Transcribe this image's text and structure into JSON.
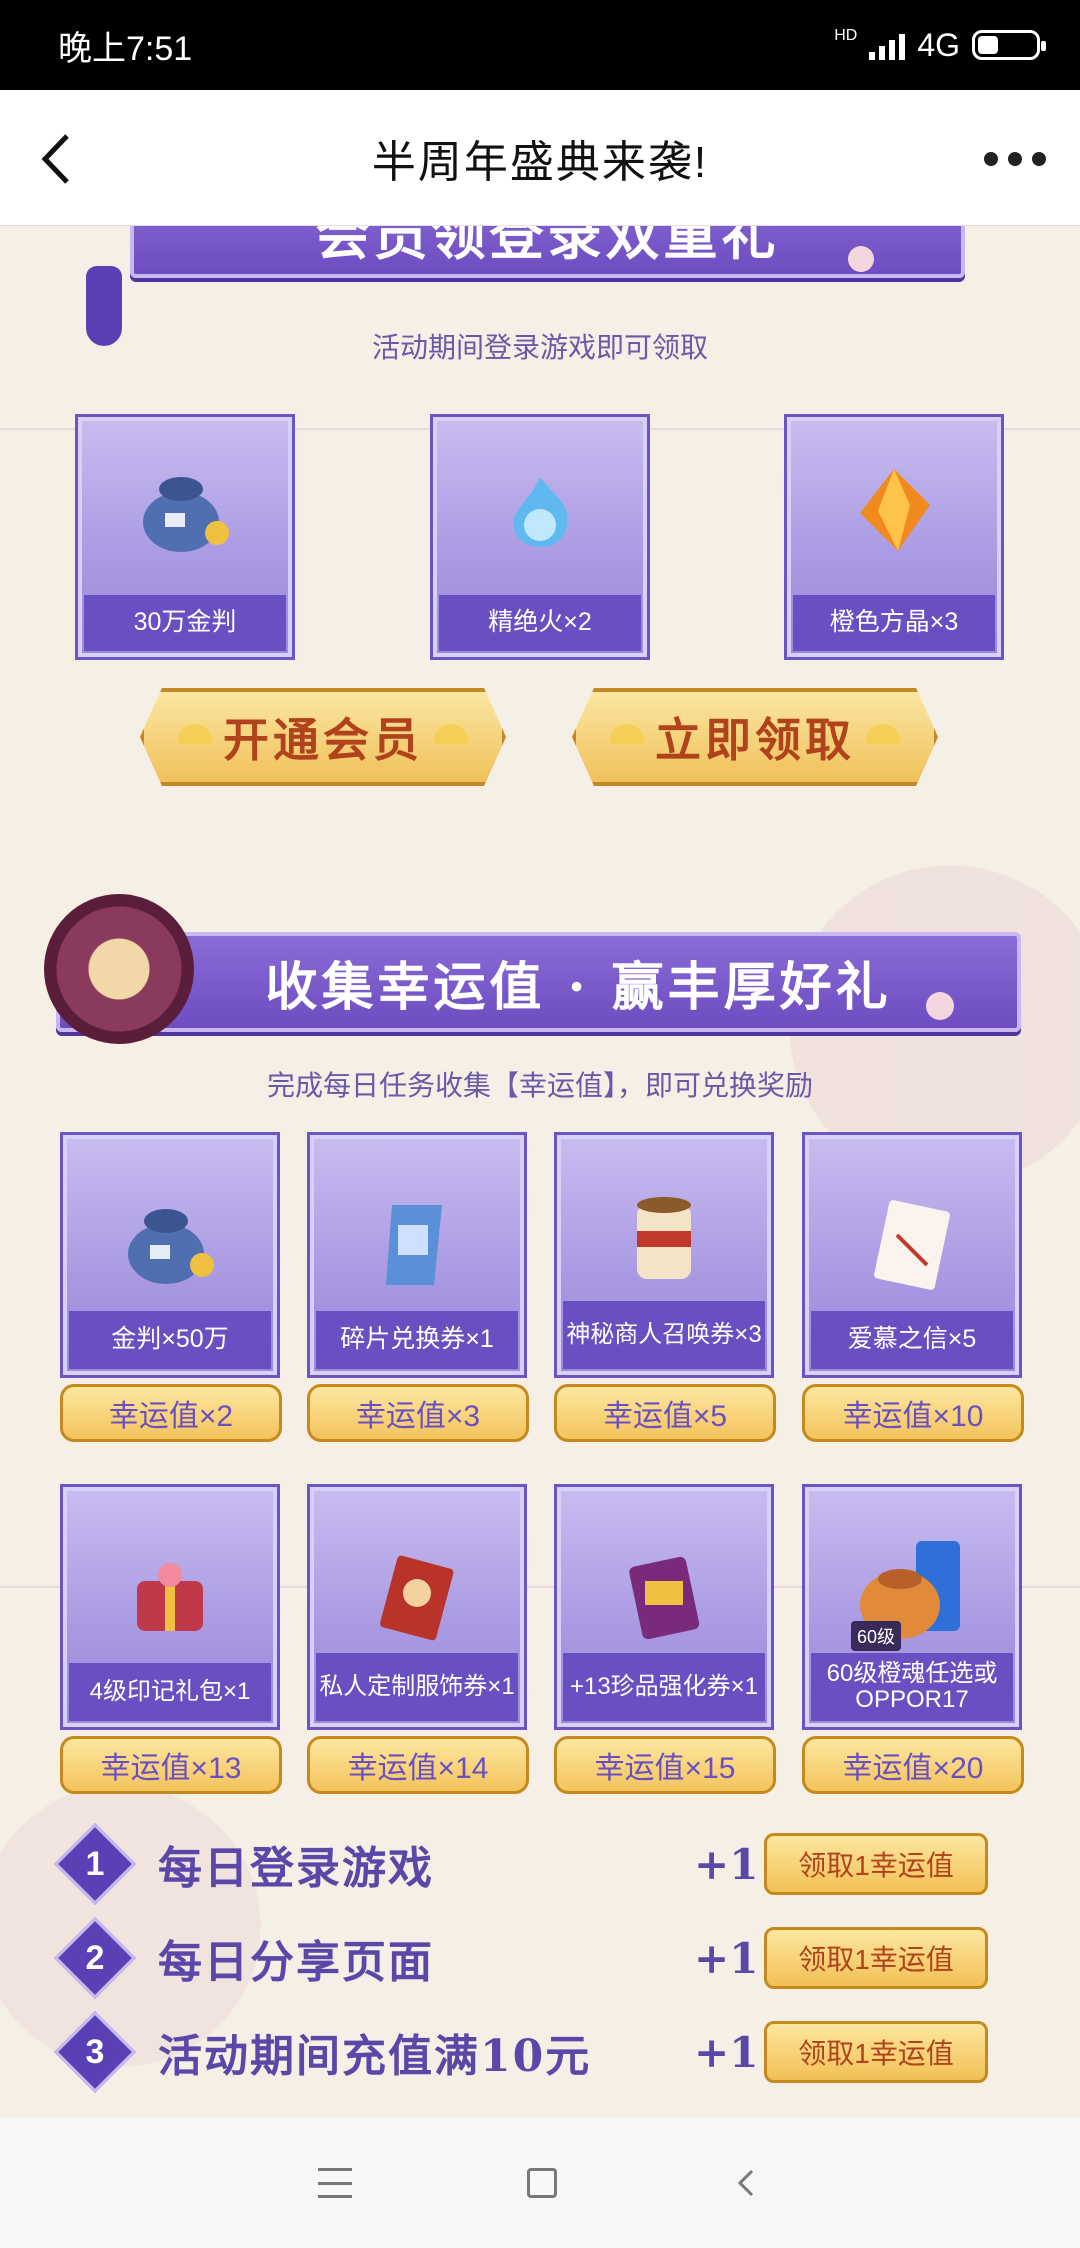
{
  "status_bar": {
    "time": "晚上7:51",
    "network": "4G",
    "hd": "HD"
  },
  "title_bar": {
    "title": "半周年盛典来袭!"
  },
  "section1": {
    "banner": "会员领登录双重礼",
    "subtitle": "活动期间登录游戏即可领取",
    "items": [
      {
        "label": "30万金判",
        "icon": "money-bag-icon"
      },
      {
        "label": "精绝火×2",
        "icon": "blue-fire-icon"
      },
      {
        "label": "橙色方晶×3",
        "icon": "orange-crystal-icon"
      }
    ],
    "buttons": {
      "open_vip": "开通会员",
      "claim_now": "立即领取"
    }
  },
  "section2": {
    "banner": "收集幸运值 · 赢丰厚好礼",
    "subtitle": "完成每日任务收集【幸运值】，即可兑换奖励",
    "items_row1": [
      {
        "label": "金判×50万",
        "cost": "幸运值×2",
        "icon": "money-bag-icon"
      },
      {
        "label": "碎片兑换券×1",
        "cost": "幸运值×3",
        "icon": "scroll-icon"
      },
      {
        "label": "神秘商人召唤券×3",
        "cost": "幸运值×5",
        "icon": "summon-scroll-icon"
      },
      {
        "label": "爱慕之信×5",
        "cost": "幸运值×10",
        "icon": "love-letter-icon"
      }
    ],
    "items_row2": [
      {
        "label": "4级印记礼包×1",
        "cost": "幸运值×13",
        "icon": "gift-box-icon"
      },
      {
        "label": "私人定制服饰券×1",
        "cost": "幸运值×14",
        "icon": "costume-ticket-icon"
      },
      {
        "label": "+13珍品强化券×1",
        "cost": "幸运值×15",
        "icon": "enhance-ticket-icon"
      },
      {
        "label": "60级橙魂任选或OPPOR17",
        "cost": "幸运值×20",
        "icon": "phone-bag-icon",
        "badge": "60级"
      }
    ]
  },
  "tasks": [
    {
      "num": "1",
      "text": "每日登录游戏",
      "plus": "+1",
      "button": "领取1幸运值"
    },
    {
      "num": "2",
      "text": "每日分享页面",
      "plus": "+1",
      "button": "领取1幸运值"
    },
    {
      "num": "3",
      "text": "活动期间充值满10元",
      "plus": "+1",
      "button": "领取1幸运值"
    }
  ],
  "colors": {
    "purple": "#6a4fc2",
    "gold": "#f3c35c",
    "accent_red": "#b0421c"
  }
}
